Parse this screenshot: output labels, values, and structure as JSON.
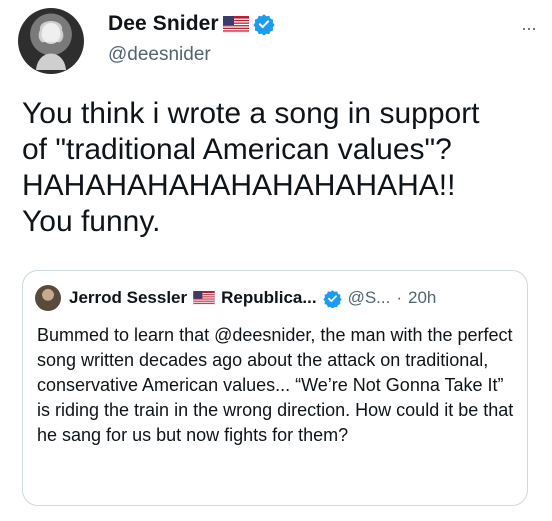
{
  "tweet": {
    "author": {
      "display_name": "Dee Snider",
      "handle": "@deesnider",
      "flag_icon": "us-flag-icon",
      "verified_icon": "verified-badge-icon"
    },
    "more_icon": "···",
    "text": "You think i wrote a song in support\nof \"traditional American values\"?\nHAHAHAHAHAHAHAHAHAHA!!\nYou funny.",
    "accent_color": "#1d9bf0"
  },
  "quoted_tweet": {
    "author": {
      "display_name": "Jerrod Sessler",
      "affiliation": "Republica...",
      "handle": "@S...",
      "flag_icon": "us-flag-icon",
      "verified_icon": "verified-badge-icon"
    },
    "separator": "·",
    "time": "20h",
    "text": "Bummed to learn that @deesnider, the man with the perfect song written decades ago about the attack on traditional, conservative American values... “We’re Not Gonna Take It” is riding the train in the wrong direction. How could it be that he sang for us but now fights for them?"
  }
}
